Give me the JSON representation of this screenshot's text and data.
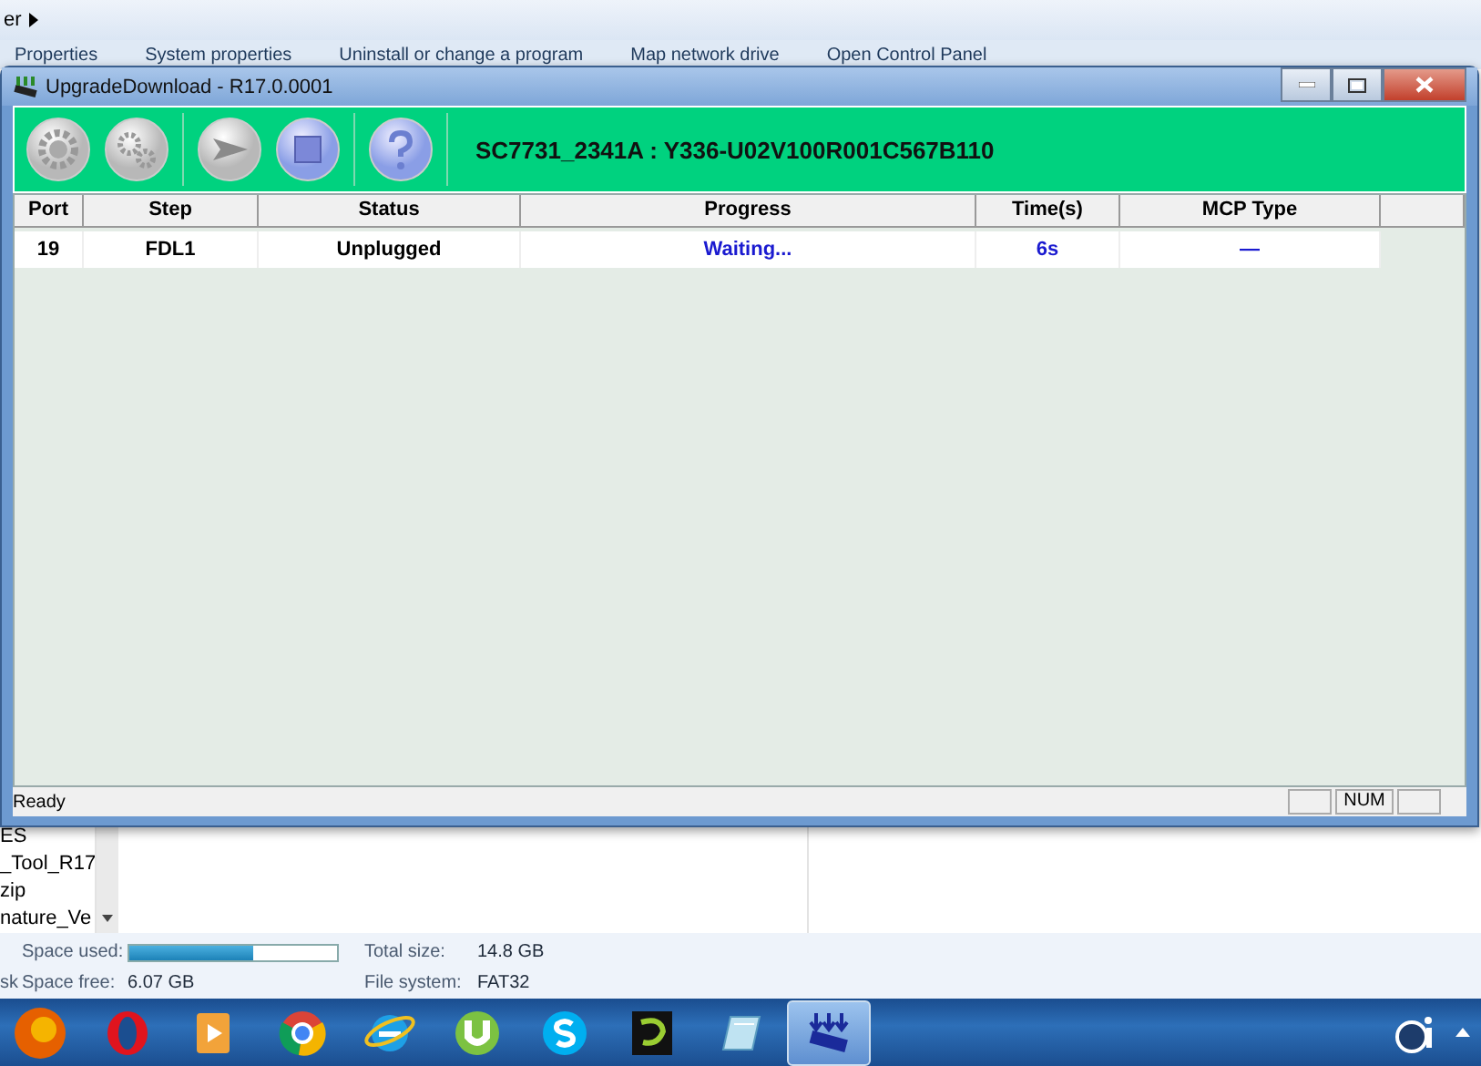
{
  "explorer": {
    "address_crumb": "er",
    "toolbar": [
      "Properties",
      "System properties",
      "Uninstall or change a program",
      "Map network drive",
      "Open Control Panel"
    ],
    "nav_items": [
      "ES",
      "_Tool_R17",
      "zip",
      "nature_Ve"
    ],
    "details": {
      "space_used_label": "Space used:",
      "space_used": {
        "level": 0.6
      },
      "total_size_label": "Total size:",
      "total_size": "14.8 GB",
      "cut_label": "sk",
      "space_free_label": "Space free:",
      "space_free": "6.07 GB",
      "file_system_label": "File system:",
      "file_system": "FAT32"
    }
  },
  "dialog": {
    "title": "UpgradeDownload - R17.0.0001",
    "tools": [
      {
        "kind": "gear"
      },
      {
        "kind": "gears"
      },
      {
        "kind": "play"
      },
      {
        "kind": "stop"
      },
      {
        "kind": "help"
      }
    ],
    "device": "SC7731_2341A : Y336-U02V100R001C567B110",
    "columns": [
      "Port",
      "Step",
      "Status",
      "Progress",
      "Time(s)",
      "MCP Type"
    ],
    "rows": [
      {
        "cells": [
          "19",
          "FDL1",
          "Unplugged",
          "Waiting...",
          "6s",
          "—"
        ]
      }
    ],
    "status": "Ready",
    "indicator": "NUM"
  },
  "taskbar": [
    {
      "kind": "firefox",
      "selected": false
    },
    {
      "kind": "opera",
      "selected": false
    },
    {
      "kind": "media",
      "selected": false
    },
    {
      "kind": "chrome",
      "selected": false
    },
    {
      "kind": "ie",
      "selected": false
    },
    {
      "kind": "torrent",
      "selected": false
    },
    {
      "kind": "skype",
      "selected": false
    },
    {
      "kind": "etisalat",
      "selected": false
    },
    {
      "kind": "notepad",
      "selected": false
    },
    {
      "kind": "download",
      "selected": true
    }
  ]
}
